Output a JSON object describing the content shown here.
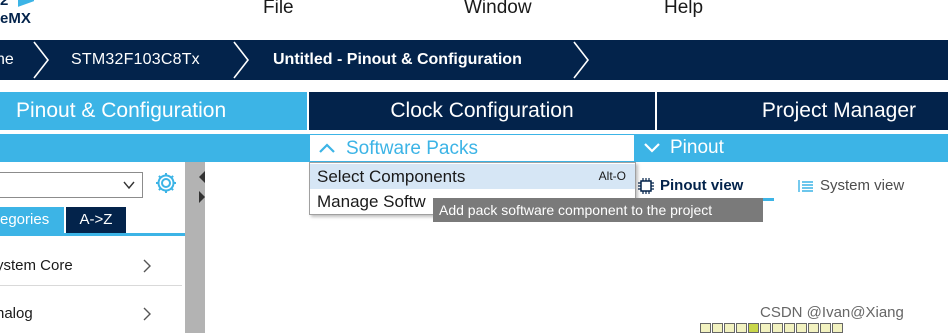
{
  "menubar": {
    "logo_line1": "2",
    "logo_line2": "eMX",
    "items": [
      "File",
      "Window",
      "Help"
    ]
  },
  "breadcrumb": {
    "items": [
      "ne",
      "STM32F103C8Tx",
      "Untitled - Pinout & Configuration"
    ]
  },
  "tabs": {
    "pinout": "Pinout & Configuration",
    "clock": "Clock Configuration",
    "project": "Project Manager"
  },
  "subbar": {
    "software_packs": "Software Packs",
    "pinout": "Pinout"
  },
  "dropdown": {
    "items": [
      {
        "label": "Select Components",
        "shortcut": "Alt-O"
      },
      {
        "label": "Manage Softw",
        "shortcut": ""
      }
    ]
  },
  "tooltip": "Add pack software component to the project",
  "left_panel": {
    "tab_categories": "egories",
    "tab_az": "A->Z",
    "rows": [
      "ystem Core",
      "nalog"
    ]
  },
  "views": {
    "pinout": "Pinout view",
    "system": "System view"
  },
  "watermark": "CSDN @Ivan@Xiang",
  "colors": {
    "accent": "#3cb4e6",
    "navy": "#03234b",
    "tooltip_bg": "#7a7a7a",
    "splitter": "#b3b3b3"
  },
  "icons": [
    "gear-icon",
    "chevron-down-icon",
    "chevron-up-icon",
    "chevron-right-icon",
    "chip-icon",
    "system-view-icon"
  ]
}
